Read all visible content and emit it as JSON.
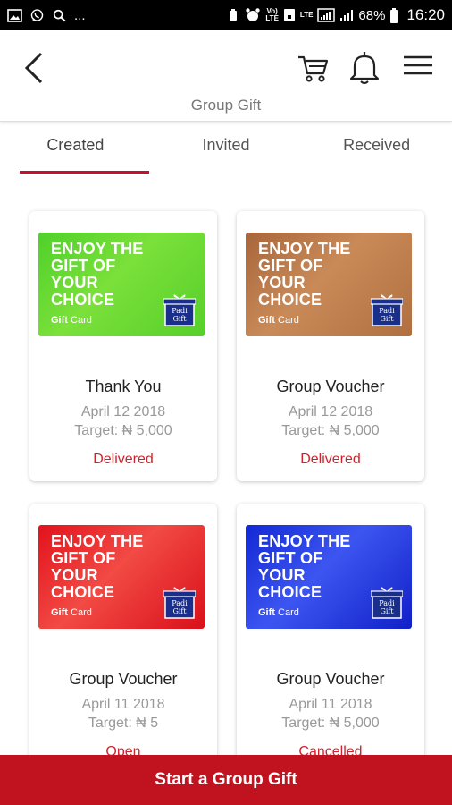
{
  "status_bar": {
    "left_icons": [
      "image-icon",
      "whatsapp-icon",
      "search-icon"
    ],
    "overflow": "...",
    "volte": "Vo)\nLTE",
    "lte": "LTE",
    "battery": "68%",
    "time": "16:20"
  },
  "header": {
    "title": "Group Gift"
  },
  "tabs": [
    {
      "label": "Created",
      "active": true
    },
    {
      "label": "Invited",
      "active": false
    },
    {
      "label": "Received",
      "active": false
    }
  ],
  "gift_card_art": {
    "headline_lines": [
      "ENJOY THE",
      "GIFT OF",
      "YOUR",
      "CHOICE"
    ],
    "sub_bold": "Gift",
    "sub_rest": " Card",
    "logo_line1": "Padi",
    "logo_line2": "Gift"
  },
  "cards": [
    {
      "title": "Thank You",
      "date": "April 12 2018",
      "target": "Target: ₦ 5,000",
      "status": "Delivered",
      "color": "#4fd12a"
    },
    {
      "title": "Group Voucher",
      "date": "April 12 2018",
      "target": "Target: ₦ 5,000",
      "status": "Delivered",
      "color": "#b5733f"
    },
    {
      "title": "Group Voucher",
      "date": "April 11 2018",
      "target": "Target: ₦ 5",
      "status": "Open",
      "color": "#e2121c"
    },
    {
      "title": "Group Voucher",
      "date": "April 11 2018",
      "target": "Target: ₦ 5,000",
      "status": "Cancelled",
      "color": "#1228d6"
    }
  ],
  "cta": {
    "label": "Start a Group Gift"
  },
  "colors": {
    "accent": "#c0121f",
    "status_text": "#d0232e",
    "muted_text": "#999999"
  }
}
